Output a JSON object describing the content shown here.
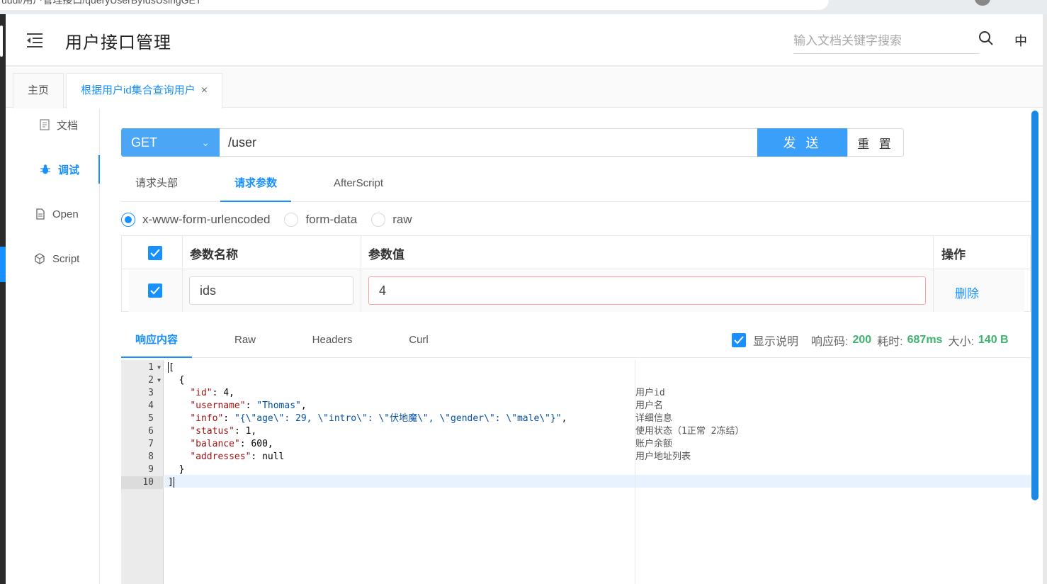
{
  "browser": {
    "url_fragment": "uuul/用户管理接口/queryUserByIdsUsingGET"
  },
  "header": {
    "title": "用户接口管理",
    "search_placeholder": "输入文档关键字搜索",
    "lang_label": "中"
  },
  "tabs": [
    {
      "label": "主页"
    },
    {
      "label": "根据用户id集合查询用户",
      "close": "×"
    }
  ],
  "sidenav": [
    {
      "label": "文档",
      "icon": "document-icon"
    },
    {
      "label": "调试",
      "icon": "bug-icon"
    },
    {
      "label": "Open",
      "icon": "file-icon"
    },
    {
      "label": "Script",
      "icon": "code-sandbox-icon"
    }
  ],
  "request": {
    "method": "GET",
    "url": "/user",
    "send_label": "发 送",
    "reset_label": "重 置"
  },
  "request_tabs": [
    "请求头部",
    "请求参数",
    "AfterScript"
  ],
  "body_types": [
    "x-www-form-urlencoded",
    "form-data",
    "raw"
  ],
  "params_table": {
    "headers": [
      "参数名称",
      "参数值",
      "操作"
    ],
    "rows": [
      {
        "name": "ids",
        "value": "4",
        "action": "删除"
      }
    ]
  },
  "response_tabs": [
    "响应内容",
    "Raw",
    "Headers",
    "Curl"
  ],
  "response_meta": {
    "show_desc_label": "显示说明",
    "code_label": "响应码:",
    "code": "200",
    "time_label": "耗时:",
    "time": "687ms",
    "size_label": "大小:",
    "size": "140 B"
  },
  "editor": {
    "line_numbers": [
      "1",
      "2",
      "3",
      "4",
      "5",
      "6",
      "7",
      "8",
      "9",
      "10"
    ],
    "notes": [
      "",
      "",
      "用户id",
      "用户名",
      "详细信息",
      "使用状态（1正常 2冻结）",
      "账户余额",
      "用户地址列表",
      "",
      ""
    ]
  },
  "colors": {
    "accent": "#1890ff",
    "method_bg": "#4ba7f5",
    "send_bg": "#3a9ff8",
    "success": "#3cb46e"
  }
}
